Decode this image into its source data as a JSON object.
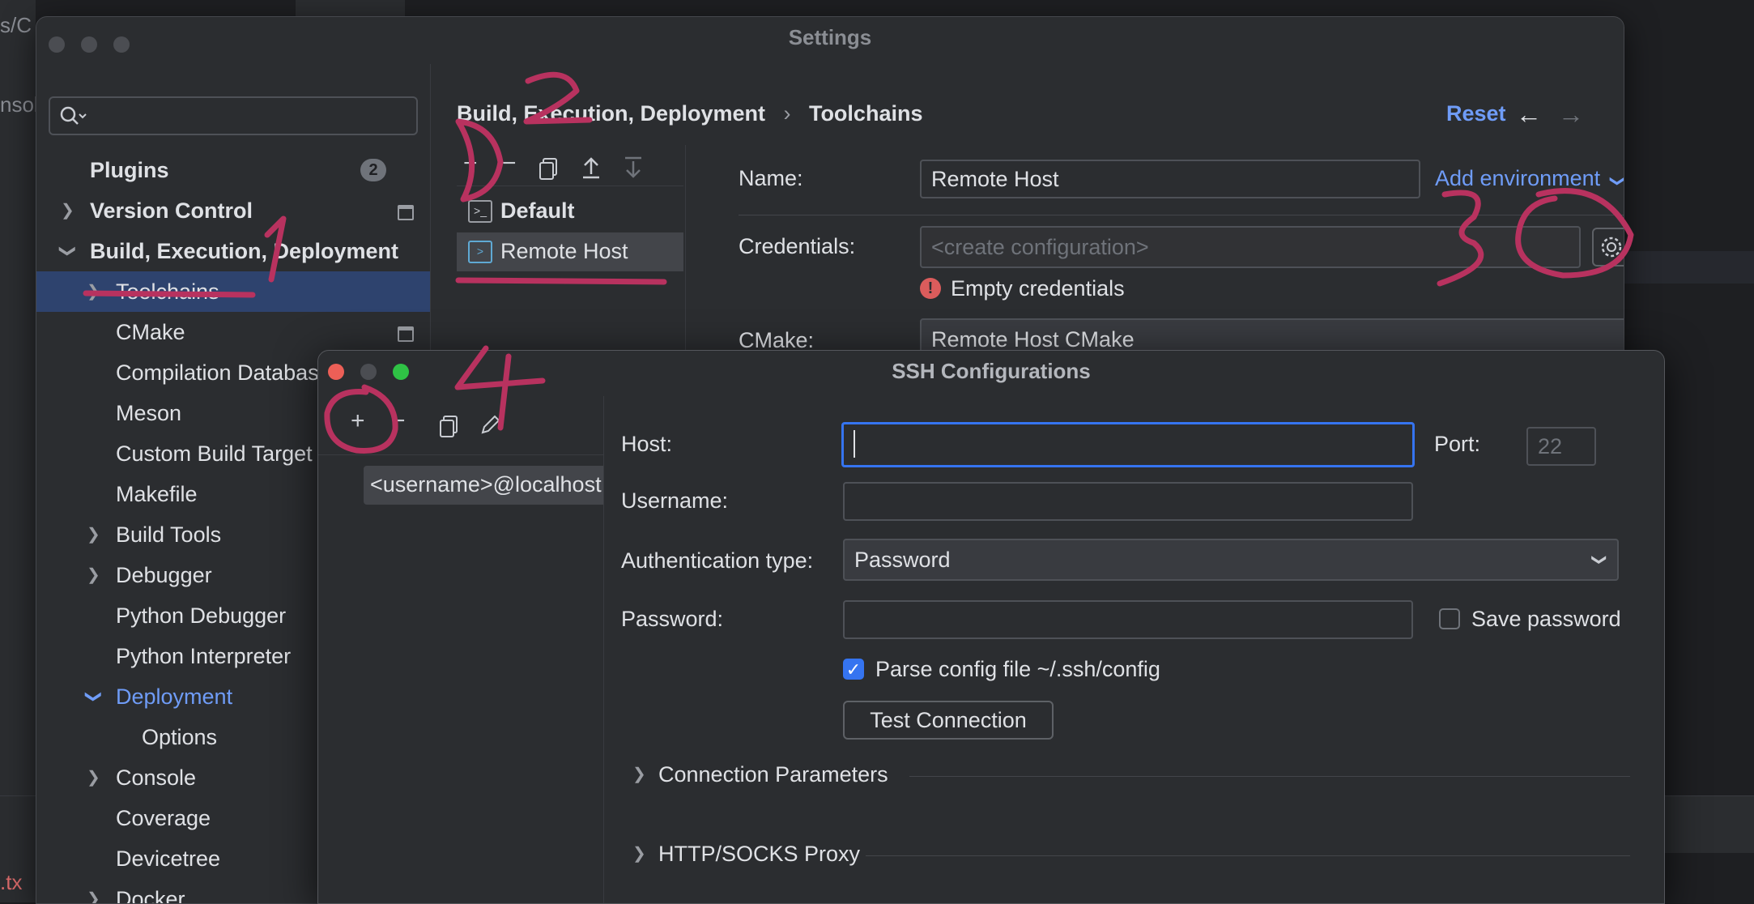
{
  "background": {
    "left_text_top": "s/C",
    "left_text_mid": "nsole",
    "left_text_bottom": ".tx"
  },
  "settings": {
    "title": "Settings",
    "search": {
      "value": "",
      "placeholder": ""
    },
    "tree": [
      {
        "label": "Plugins",
        "badge": "2"
      },
      {
        "label": "Version Control"
      },
      {
        "label": "Build, Execution, Deployment"
      },
      {
        "label": "Toolchains"
      },
      {
        "label": "CMake"
      },
      {
        "label": "Compilation Databas"
      },
      {
        "label": "Meson"
      },
      {
        "label": "Custom Build Target"
      },
      {
        "label": "Makefile"
      },
      {
        "label": "Build Tools"
      },
      {
        "label": "Debugger"
      },
      {
        "label": "Python Debugger"
      },
      {
        "label": "Python Interpreter"
      },
      {
        "label": "Deployment"
      },
      {
        "label": "Options"
      },
      {
        "label": "Console"
      },
      {
        "label": "Coverage"
      },
      {
        "label": "Devicetree"
      },
      {
        "label": "Docker"
      }
    ],
    "breadcrumb": {
      "parent": "Build, Execution, Deployment",
      "separator": "›",
      "current": "Toolchains"
    },
    "reset_label": "Reset",
    "toolchains": [
      {
        "label": "Default"
      },
      {
        "label": "Remote Host"
      }
    ],
    "form": {
      "name_label": "Name:",
      "name_value": "Remote Host",
      "add_environment": "Add environment",
      "credentials_label": "Credentials:",
      "credentials_placeholder": "<create configuration>",
      "error_text": "Empty credentials",
      "cmake_label": "CMake:",
      "cmake_value": "Remote Host CMake"
    }
  },
  "ssh": {
    "title": "SSH Configurations",
    "list": [
      "<username>@localhost"
    ],
    "host_label": "Host:",
    "host_value": "",
    "port_label": "Port:",
    "port_placeholder": "22",
    "username_label": "Username:",
    "username_value": "",
    "auth_label": "Authentication type:",
    "auth_value": "Password",
    "password_label": "Password:",
    "password_value": "",
    "save_password": "Save password",
    "save_password_checked": false,
    "parse_config": "Parse config file ~/.ssh/config",
    "parse_config_checked": true,
    "test_connection": "Test Connection",
    "connection_parameters": "Connection Parameters",
    "proxy": "HTTP/SOCKS Proxy"
  },
  "annotations": {
    "color": "#b8325f"
  },
  "colors": {
    "accent": "#3574f0",
    "link": "#6f9cf7",
    "selection": "#2e436e",
    "error": "#db5c5c"
  }
}
